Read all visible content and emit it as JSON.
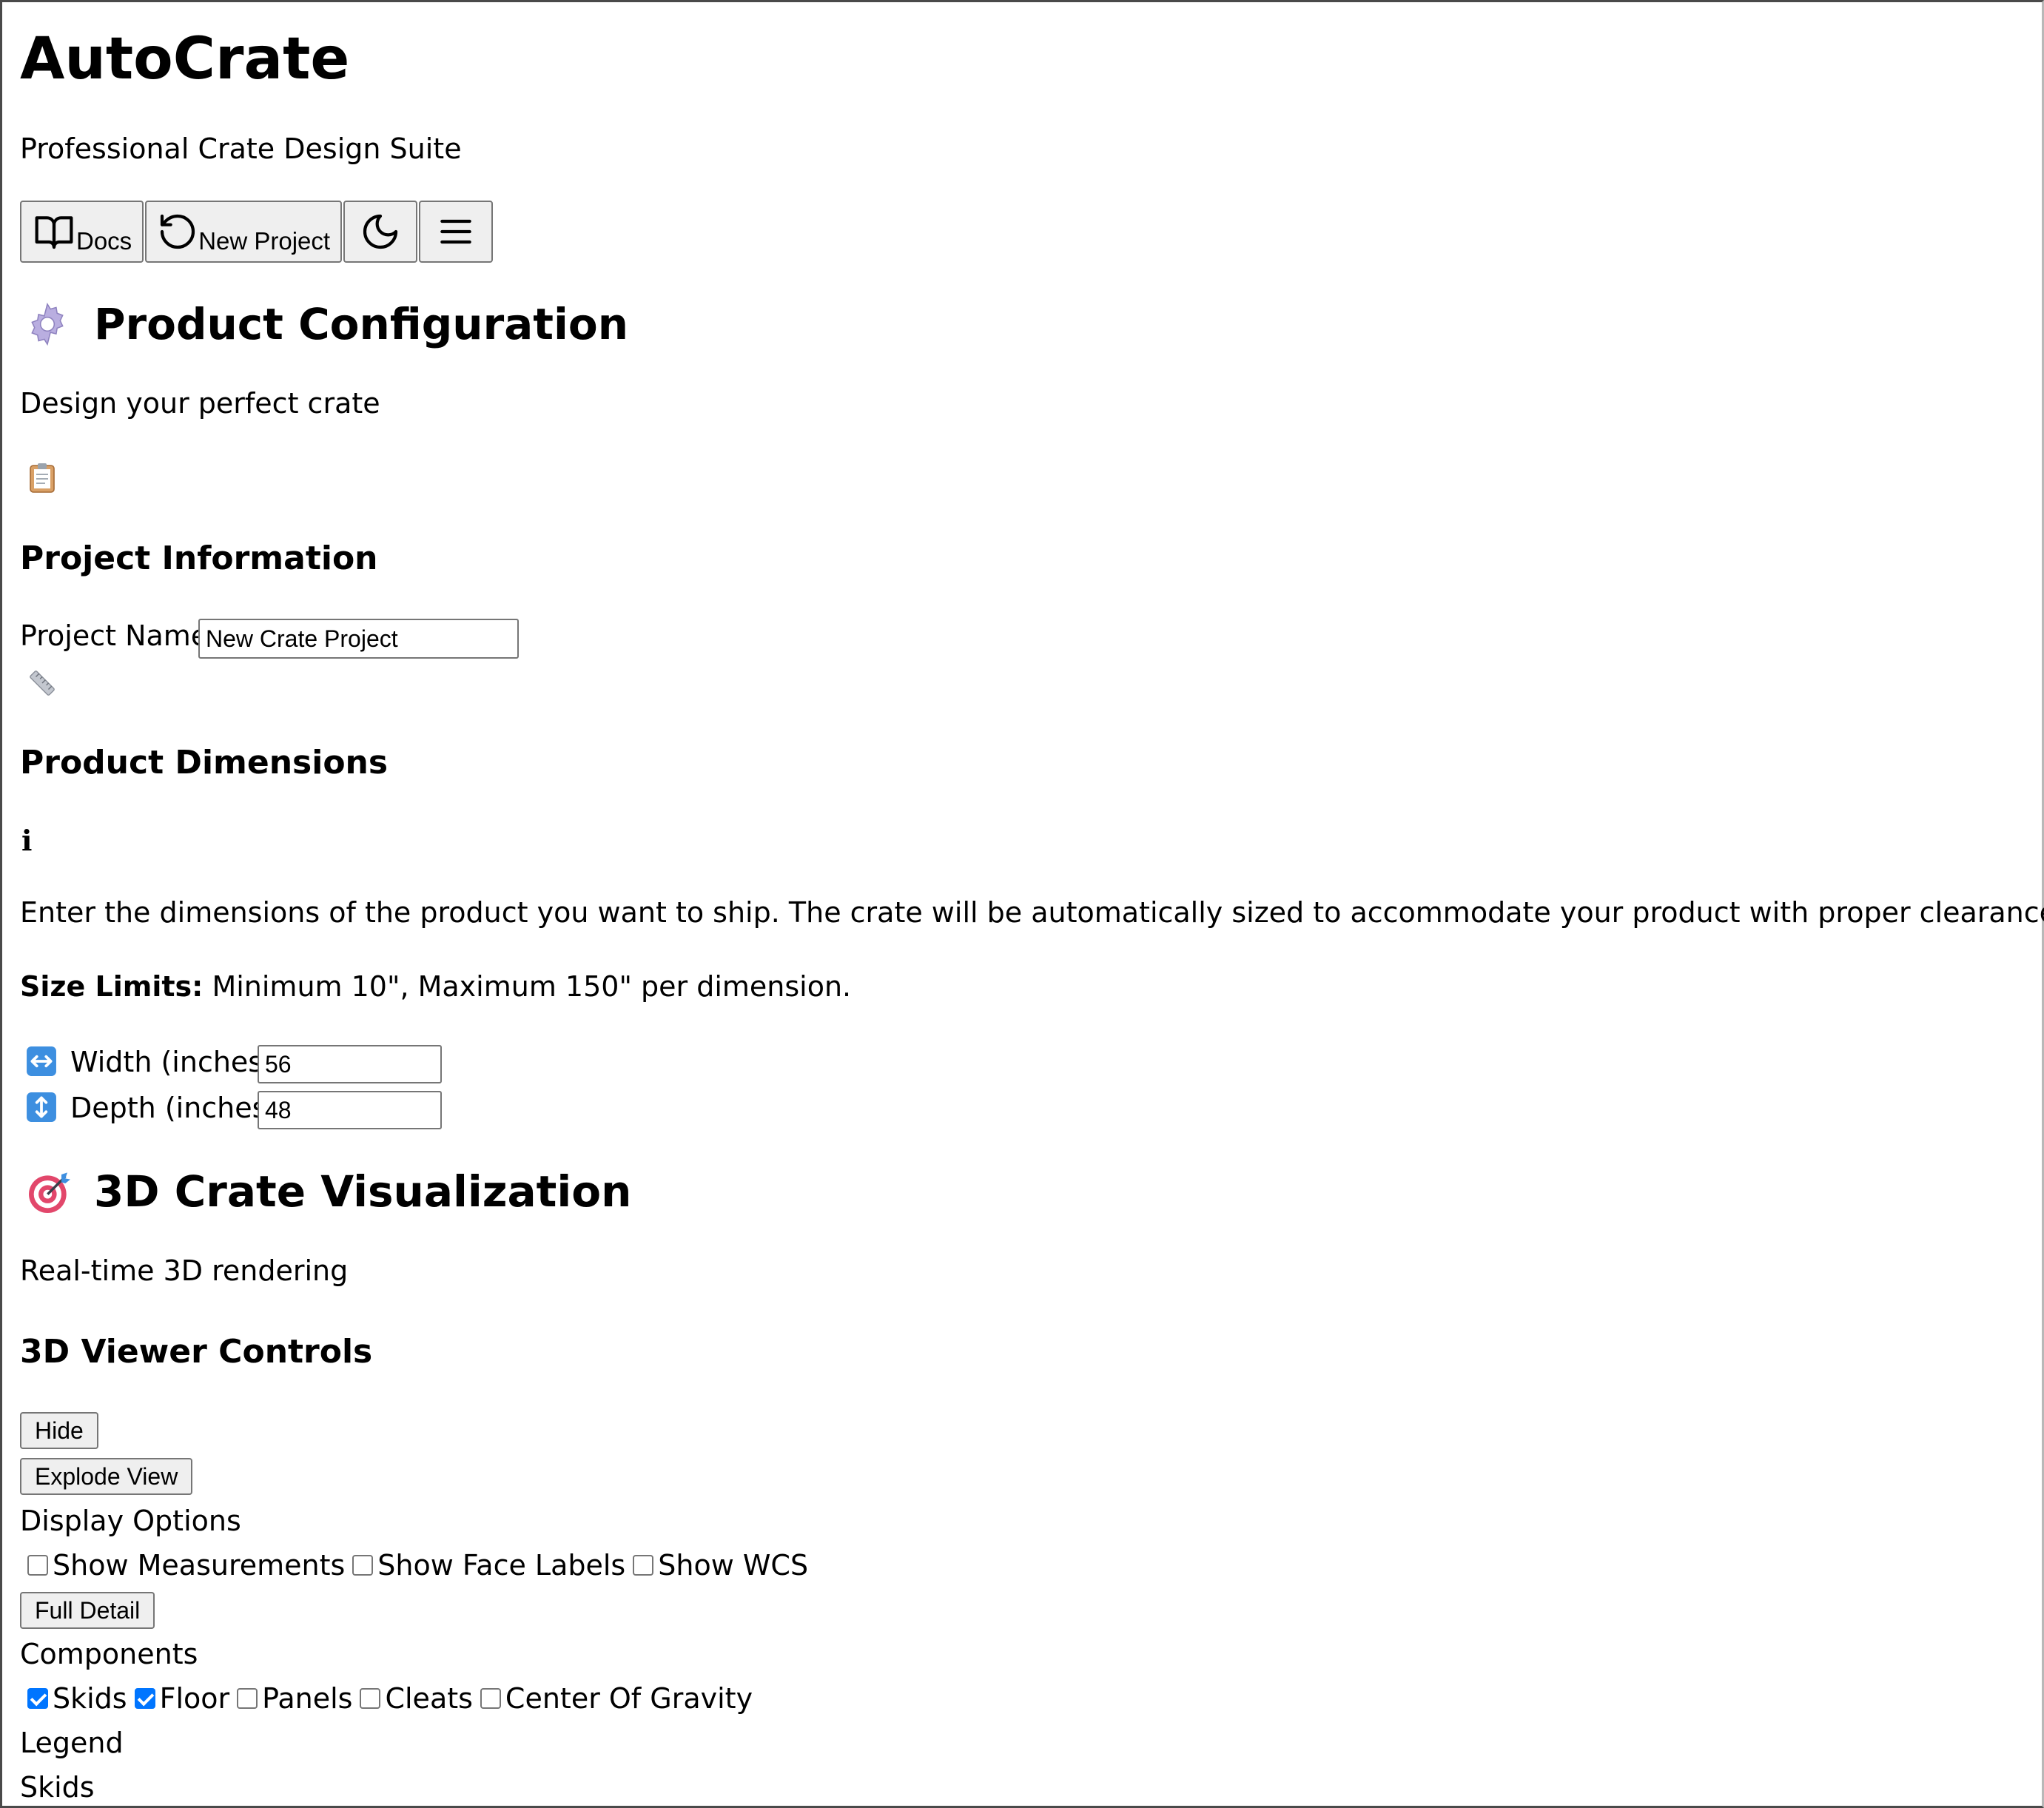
{
  "app": {
    "title": "AutoCrate",
    "subtitle": "Professional Crate Design Suite"
  },
  "toolbar": {
    "docs_label": "Docs",
    "docs_icon": "book-open-icon",
    "new_project_label": "New Project",
    "new_project_icon": "rotate-ccw-icon",
    "theme_icon": "moon-icon",
    "menu_icon": "hamburger-menu-icon"
  },
  "product_config": {
    "icon": "gear-icon",
    "title": "Product Configuration",
    "subtitle": "Design your perfect crate",
    "clipboard_icon": "clipboard-icon"
  },
  "project_info": {
    "heading": "Project Information",
    "name_label": "Project Name",
    "name_value": "New Crate Project",
    "ruler_icon": "ruler-icon"
  },
  "dimensions": {
    "heading": "Product Dimensions",
    "info_icon_text": "i",
    "description": "Enter the dimensions of the product you want to ship. The crate will be automatically sized to accommodate your product with proper clearances.",
    "limits_label": "Size Limits:",
    "limits_text": " Minimum 10\", Maximum 150\" per dimension.",
    "width_icon": "left-right-arrow-icon",
    "width_label": "Width (inches)",
    "width_value": "56",
    "depth_icon": "up-down-arrow-icon",
    "depth_label": "Depth (inches)",
    "depth_value": "48"
  },
  "visualization": {
    "icon": "target-icon",
    "title": "3D Crate Visualization",
    "subtitle": "Real-time 3D rendering"
  },
  "viewer_controls": {
    "heading": "3D Viewer Controls",
    "hide_label": "Hide",
    "explode_label": "Explode View",
    "display_options_label": "Display Options",
    "display_options": [
      {
        "label": "Show Measurements",
        "checked": false
      },
      {
        "label": "Show Face Labels",
        "checked": false
      },
      {
        "label": "Show WCS",
        "checked": false
      }
    ],
    "detail_label": "Full Detail",
    "components_label": "Components",
    "components": [
      {
        "label": "Skids",
        "checked": true
      },
      {
        "label": "Floor",
        "checked": true
      },
      {
        "label": "Panels",
        "checked": false
      },
      {
        "label": "Cleats",
        "checked": false
      },
      {
        "label": "Center Of Gravity",
        "checked": false
      }
    ],
    "legend_label": "Legend",
    "legend_items": [
      "Skids"
    ]
  },
  "colors": {
    "checkbox_accent": "#0075ff",
    "button_bg": "#efefef",
    "border": "#767676"
  }
}
